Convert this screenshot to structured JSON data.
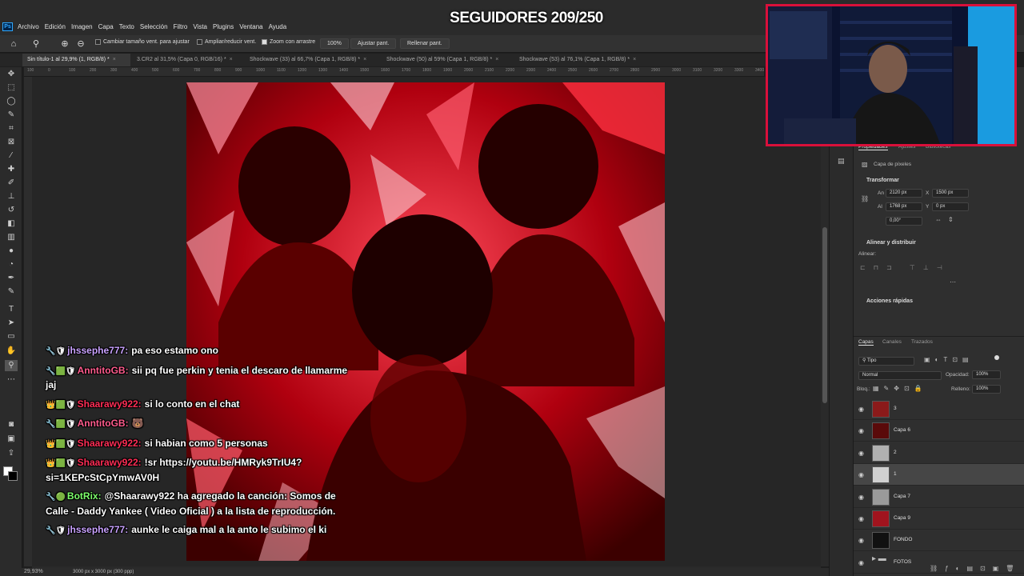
{
  "app": {
    "logo": "Ps",
    "menu": [
      "Archivo",
      "Edición",
      "Imagen",
      "Capa",
      "Texto",
      "Selección",
      "Filtro",
      "Vista",
      "Plugins",
      "Ventana",
      "Ayuda"
    ]
  },
  "options": {
    "resize_windows": "Cambiar tamaño vent. para ajustar",
    "zoom_all": "Ampliar/reducir vent.",
    "scrubby_zoom": "Zoom con arrastre",
    "zoom_100": "100%",
    "fit_screen": "Ajustar pant.",
    "fill_screen": "Rellenar pant."
  },
  "tabs": [
    {
      "label": "Sin título-1 al 29,9% (1, RGB/8) *",
      "active": true
    },
    {
      "label": "3.CR2 al 31,5% (Capa 0, RGB/16) *",
      "active": false
    },
    {
      "label": "Shockwave (33) al 66,7% (Capa 1, RGB/8) *",
      "active": false
    },
    {
      "label": "Shockwave (50) al 59% (Capa 1, RGB/8) *",
      "active": false
    },
    {
      "label": "Shockwave (53) al 76,1% (Capa 1, RGB/8) *",
      "active": false
    }
  ],
  "ruler": [
    "100",
    "0",
    "100",
    "200",
    "300",
    "400",
    "500",
    "600",
    "700",
    "800",
    "900",
    "1000",
    "1100",
    "1200",
    "1300",
    "1400",
    "1500",
    "1600",
    "1700",
    "1800",
    "1900",
    "2000",
    "2100",
    "2200",
    "2300",
    "2400",
    "2500",
    "2600",
    "2700",
    "2800",
    "2900",
    "3000",
    "3100",
    "3200",
    "3300",
    "3400"
  ],
  "overlay": {
    "followers": "SEGUIDORES 209/250"
  },
  "chat": [
    {
      "badges": "🔧🛡",
      "user": "jhssephe777:",
      "user_color": "#c9a2ff",
      "text": "pa eso estamo ono"
    },
    {
      "badges": "🔧🟩🛡",
      "user": "AnntitoGB:",
      "user_color": "#ff5c8d",
      "text": "sii pq fue perkin y tenia el descaro de llamarme jaj"
    },
    {
      "badges": "👑🟩🛡",
      "user": "Shaarawy922:",
      "user_color": "#ff2d55",
      "text": "si lo conto en el chat"
    },
    {
      "badges": "🔧🟩🛡",
      "user": "AnntitoGB:",
      "user_color": "#ff5c8d",
      "text": "🐻"
    },
    {
      "badges": "👑🟩🛡",
      "user": "Shaarawy922:",
      "user_color": "#ff2d55",
      "text": "si habian como 5 personas"
    },
    {
      "badges": "👑🟩🛡",
      "user": "Shaarawy922:",
      "user_color": "#ff2d55",
      "text": "!sr https://youtu.be/HMRyk9TrIU4?si=1KEPcStCpYmwAV0H"
    },
    {
      "badges": "🔧🟢",
      "user": "BotRix:",
      "user_color": "#7dff6b",
      "text": "@Shaarawy922 ha agregado la canción: Somos de Calle - Daddy Yankee ( Video Oficial ) a la lista de reproducción."
    },
    {
      "badges": "🔧🛡",
      "user": "jhssephe777:",
      "user_color": "#c9a2ff",
      "text": "aunke le caiga mal a la anto le subimo el ki"
    }
  ],
  "properties": {
    "tabs": [
      "Propiedades",
      "Ajustes",
      "Bibliotecas"
    ],
    "pixel_layer": "Capa de píxeles",
    "transform_title": "Transformar",
    "w_label": "An",
    "w_value": "2120 px",
    "x_label": "X",
    "x_value": "1500 px",
    "h_label": "Al",
    "h_value": "1768 px",
    "y_label": "Y",
    "y_value": "0 px",
    "angle": "0,00°",
    "align_title": "Alinear y distribuir",
    "align_label": "Alinear:",
    "quick_actions": "Acciones rápidas"
  },
  "layers_panel": {
    "tabs": [
      "Capas",
      "Canales",
      "Trazados"
    ],
    "filter": "Tipo",
    "blend_mode": "Normal",
    "opacity_label": "Opacidad:",
    "opacity_value": "100%",
    "lock_label": "Bloq.:",
    "fill_label": "Relleno:",
    "fill_value": "100%",
    "layers": [
      {
        "name": "3",
        "selected": false,
        "thumb": "#8b1a1a"
      },
      {
        "name": "Capa 6",
        "selected": false,
        "thumb": "#5a0a0a"
      },
      {
        "name": "2",
        "selected": false,
        "thumb": "#b0b0b0"
      },
      {
        "name": "1",
        "selected": true,
        "thumb": "#d0d0d0"
      },
      {
        "name": "Capa 7",
        "selected": false,
        "thumb": "#9a9a9a"
      },
      {
        "name": "Capa 9",
        "selected": false,
        "thumb": "#a0141e"
      },
      {
        "name": "FONDO",
        "selected": false,
        "thumb": "#111111"
      },
      {
        "name": "FOTOS",
        "selected": false,
        "thumb": "folder"
      }
    ]
  },
  "status": {
    "zoom": "29,93%",
    "doc_info": "3000 px x 3000 px (300 ppp)"
  }
}
